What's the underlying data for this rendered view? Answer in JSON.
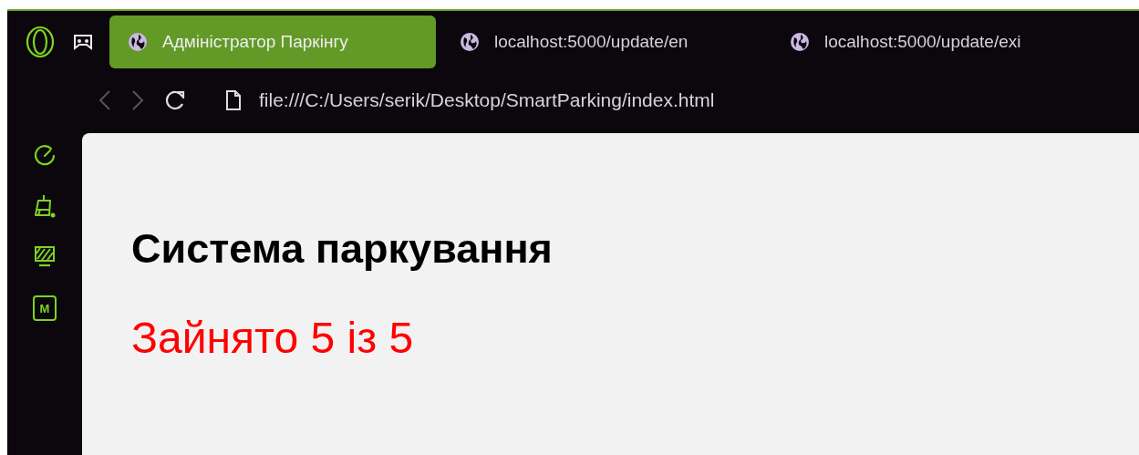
{
  "tabs": [
    {
      "title": "Адміністратор Паркінгу",
      "selected": true
    },
    {
      "title": "localhost:5000/update/en",
      "selected": false
    },
    {
      "title": "localhost:5000/update/exi",
      "selected": false
    }
  ],
  "address_bar": {
    "url": "file:///C:/Users/serik/Desktop/SmartParking/index.html"
  },
  "sidebar": {
    "items": [
      {
        "kind": "speed"
      },
      {
        "kind": "clean"
      },
      {
        "kind": "screen"
      },
      {
        "kind": "chip",
        "label": "M"
      }
    ]
  },
  "page": {
    "heading": "Система паркування",
    "status": "Зайнято 5 із 5"
  }
}
